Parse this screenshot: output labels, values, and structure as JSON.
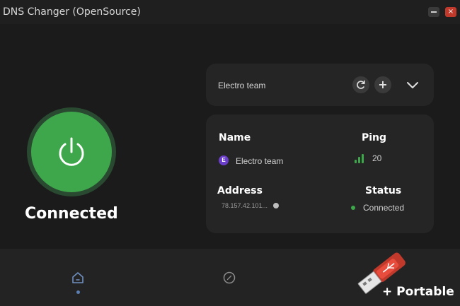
{
  "window": {
    "title": "DNS Changer (OpenSource)",
    "close_glyph": "×"
  },
  "connection": {
    "state_label": "Connected"
  },
  "dns_selector": {
    "selected": "Electro team",
    "refresh_icon": "refresh-icon",
    "add_glyph": "+"
  },
  "server_info": {
    "name_header": "Name",
    "name_value": "Electro team",
    "ping_header": "Ping",
    "ping_value": "20",
    "address_header": "Address",
    "address_value": "78.157.42.101...",
    "status_header": "Status",
    "status_value": "Connected"
  },
  "watermark": {
    "text": "+ Portable"
  },
  "colors": {
    "accent_green": "#3ea74b",
    "background": "#1b1b1b",
    "card": "#252525",
    "close_red": "#c0392b",
    "server_purple": "#6a3ec9"
  }
}
